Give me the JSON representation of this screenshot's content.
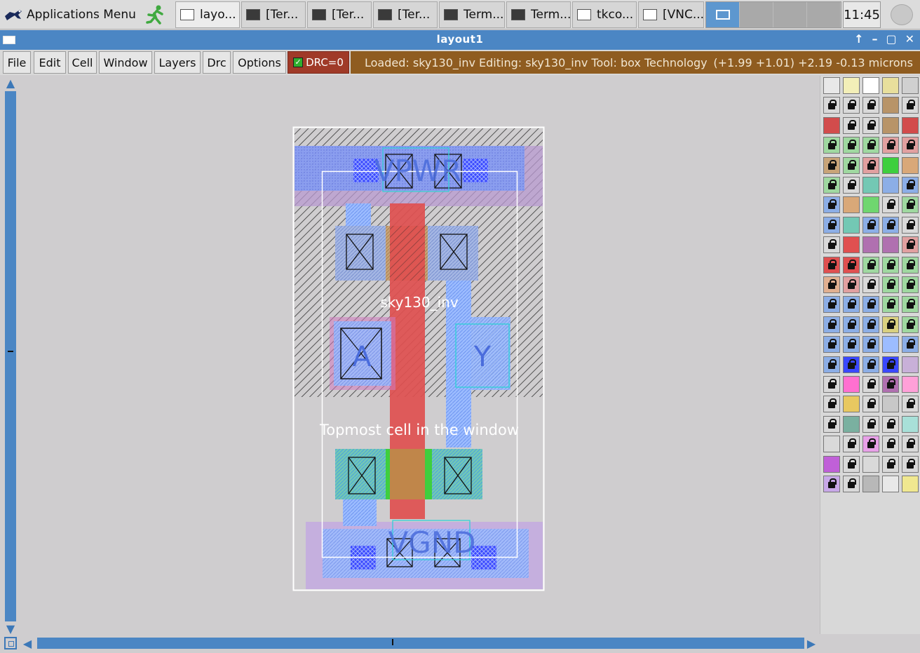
{
  "taskbar": {
    "apps_menu": "Applications Menu",
    "tasks": [
      {
        "label": "layo...",
        "kind": "window",
        "active": true
      },
      {
        "label": "[Ter...",
        "kind": "term",
        "active": false
      },
      {
        "label": "[Ter...",
        "kind": "term",
        "active": false
      },
      {
        "label": "[Ter...",
        "kind": "term",
        "active": false
      },
      {
        "label": "Term...",
        "kind": "term",
        "active": false
      },
      {
        "label": "Term...",
        "kind": "term",
        "active": false
      },
      {
        "label": "tkco...",
        "kind": "window",
        "active": false
      },
      {
        "label": "[VNC...",
        "kind": "window",
        "active": false
      }
    ],
    "clock": "11:45"
  },
  "window": {
    "title": "layout1",
    "controls": [
      "↑",
      "–",
      "▢",
      "✕"
    ]
  },
  "menubar": {
    "items": [
      "File",
      "Edit",
      "Cell",
      "Window",
      "Layers",
      "Drc",
      "Options"
    ],
    "drc_label": "DRC=0",
    "status": "Loaded: sky130_inv Editing: sky130_inv Tool: box  Technology",
    "coords": "(+1.99 +1.01) +2.19 -0.13 microns"
  },
  "layout": {
    "labels": {
      "vpwr": "VPWR",
      "vgnd": "VGND",
      "a": "A",
      "y": "Y",
      "cell": "sky130_inv",
      "topmost": "Topmost cell in the window"
    },
    "colors": {
      "metal1_blue": "#6e82e8",
      "poly_red": "#e05050",
      "diff_green": "#3ecf3e",
      "nwell_purple": "#b4a4dc",
      "cyan_outline": "#34d0d8",
      "local_interconnect": "#7ea6ff",
      "hatch_black": "#222222"
    }
  }
}
